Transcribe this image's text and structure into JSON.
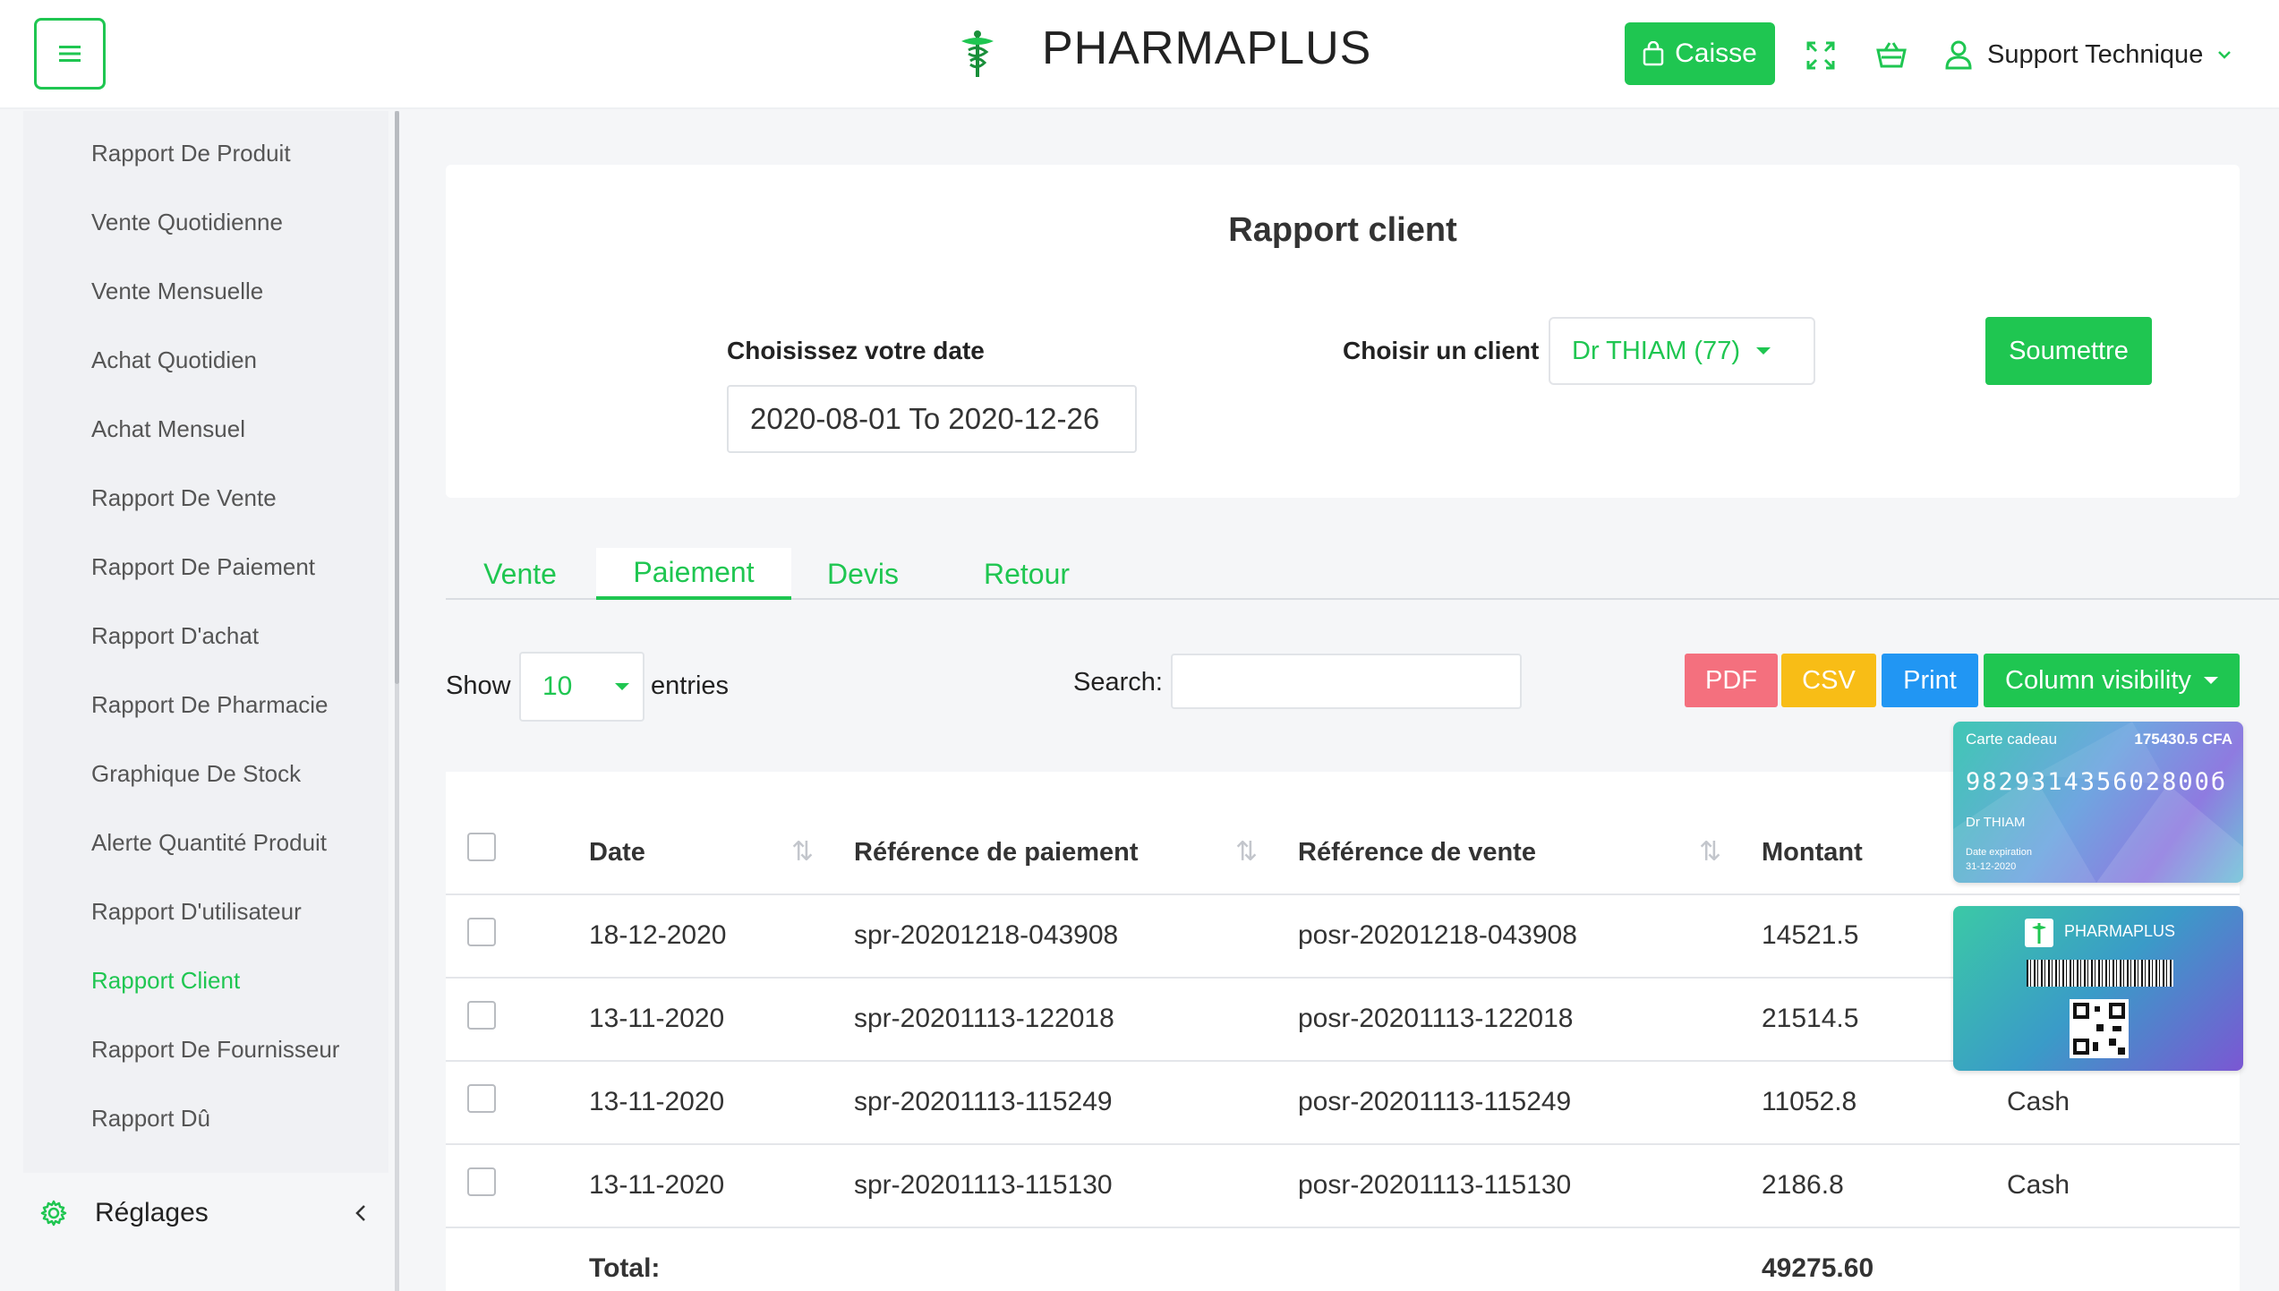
{
  "header": {
    "brand": "PHARMAPLUS",
    "caisse_label": "Caisse",
    "user_name": "Support Technique"
  },
  "sidebar": {
    "items": [
      {
        "label": "Rapport De Produit"
      },
      {
        "label": "Vente Quotidienne"
      },
      {
        "label": "Vente Mensuelle"
      },
      {
        "label": "Achat Quotidien"
      },
      {
        "label": "Achat Mensuel"
      },
      {
        "label": "Rapport De Vente"
      },
      {
        "label": "Rapport De Paiement"
      },
      {
        "label": "Rapport D'achat"
      },
      {
        "label": "Rapport De Pharmacie"
      },
      {
        "label": "Graphique De Stock"
      },
      {
        "label": "Alerte Quantité Produit"
      },
      {
        "label": "Rapport D'utilisateur"
      },
      {
        "label": "Rapport Client",
        "active": true
      },
      {
        "label": "Rapport De Fournisseur"
      },
      {
        "label": "Rapport Dû"
      }
    ],
    "settings_label": "Réglages"
  },
  "report": {
    "title": "Rapport client",
    "date_label": "Choisissez votre date",
    "date_value": "2020-08-01 To 2020-12-26",
    "client_label": "Choisir un client",
    "client_value": "Dr THIAM (77)",
    "submit_label": "Soumettre"
  },
  "tabs": [
    {
      "label": "Vente"
    },
    {
      "label": "Paiement",
      "active": true
    },
    {
      "label": "Devis"
    },
    {
      "label": "Retour"
    }
  ],
  "controls": {
    "show_label": "Show",
    "page_length": "10",
    "entries_label": "entries",
    "search_label": "Search:",
    "pdf_label": "PDF",
    "csv_label": "CSV",
    "print_label": "Print",
    "colvis_label": "Column visibility"
  },
  "table": {
    "columns": [
      "Date",
      "Référence de paiement",
      "Référence de vente",
      "Montant"
    ],
    "rows": [
      {
        "date": "18-12-2020",
        "payment_ref": "spr-20201218-043908",
        "sale_ref": "posr-20201218-043908",
        "amount": "14521.5",
        "method": ""
      },
      {
        "date": "13-11-2020",
        "payment_ref": "spr-20201113-122018",
        "sale_ref": "posr-20201113-122018",
        "amount": "21514.5",
        "method": ""
      },
      {
        "date": "13-11-2020",
        "payment_ref": "spr-20201113-115249",
        "sale_ref": "posr-20201113-115249",
        "amount": "11052.8",
        "method": "Cash"
      },
      {
        "date": "13-11-2020",
        "payment_ref": "spr-20201113-115130",
        "sale_ref": "posr-20201113-115130",
        "amount": "2186.8",
        "method": "Cash"
      }
    ],
    "total_label": "Total:",
    "total_value": "49275.60"
  },
  "gift_card": {
    "title": "Carte cadeau",
    "balance": "175430.5 CFA",
    "number": "982931435602800б",
    "holder": "Dr THIAM",
    "expiry_label": "Date expiration",
    "expiry": "31-12-2020",
    "back_brand": "PHARMAPLUS"
  },
  "colors": {
    "accent": "#1fc651",
    "pdf": "#f4707e",
    "csv": "#f8bd16",
    "print": "#2196f3"
  }
}
